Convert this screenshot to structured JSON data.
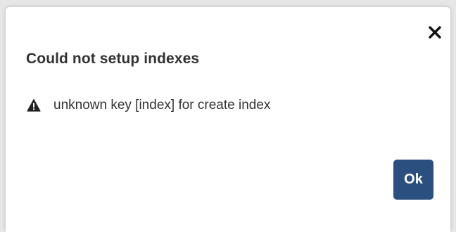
{
  "dialog": {
    "title": "Could not setup indexes",
    "message": "unknown key [index] for create index",
    "ok_label": "Ok",
    "close_icon": "close-icon",
    "warning_icon": "warning-icon"
  },
  "colors": {
    "ok_button": "#2b4f7f",
    "text": "#333333",
    "dialog_bg": "#ffffff"
  }
}
